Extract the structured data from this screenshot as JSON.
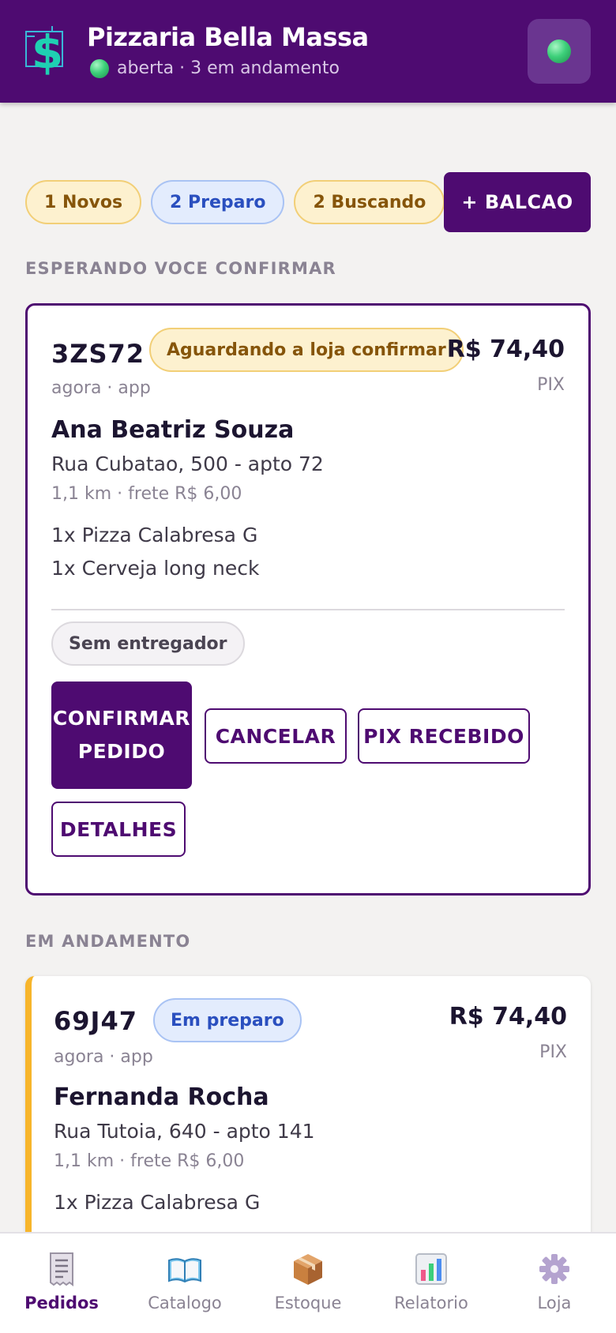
{
  "header": {
    "store_name": "Pizzaria Bella Massa",
    "status_text": "aberta · 3 em andamento",
    "logo_icon": "dollar-sign-icon",
    "status_color": "#3dd07a"
  },
  "filters": [
    {
      "label": "1 Novos",
      "style": "yellow"
    },
    {
      "label": "2 Preparo",
      "style": "blue"
    },
    {
      "label": "2 Buscando",
      "style": "yellow"
    }
  ],
  "balcao_button": "+ BALCAO",
  "sections": {
    "pending_title": "ESPERANDO VOCE CONFIRMAR",
    "progress_title": "EM ANDAMENTO"
  },
  "pending_order": {
    "code": "3ZS72",
    "status": "Aguardando a loja confirmar",
    "price": "R$ 74,40",
    "payment": "PIX",
    "meta": "agora · app",
    "customer": "Ana Beatriz Souza",
    "address": "Rua Cubatao, 500 - apto 72",
    "distance": "1,1 km · frete R$ 6,00",
    "items": [
      "1x Pizza Calabresa G",
      "1x Cerveja long neck"
    ],
    "courier": "Sem entregador",
    "actions": {
      "confirm_line1": "CONFIRMAR",
      "confirm_line2": "PEDIDO",
      "cancel": "CANCELAR",
      "pix": "PIX RECEBIDO",
      "details": "DETALHES"
    }
  },
  "progress_order": {
    "code": "69J47",
    "status": "Em preparo",
    "price": "R$ 74,40",
    "payment": "PIX",
    "meta": "agora · app",
    "customer": "Fernanda Rocha",
    "address": "Rua Tutoia, 640 - apto 141",
    "distance": "1,1 km · frete R$ 6,00",
    "items": [
      "1x Pizza Calabresa G"
    ]
  },
  "nav": [
    {
      "label": "Pedidos",
      "icon": "receipt-icon",
      "active": true
    },
    {
      "label": "Catalogo",
      "icon": "book-icon",
      "active": false
    },
    {
      "label": "Estoque",
      "icon": "package-icon",
      "active": false
    },
    {
      "label": "Relatorio",
      "icon": "bar-chart-icon",
      "active": false
    },
    {
      "label": "Loja",
      "icon": "gear-icon",
      "active": false
    }
  ],
  "colors": {
    "brand": "#4e0b71",
    "accent_progress": "#f7b52b"
  }
}
